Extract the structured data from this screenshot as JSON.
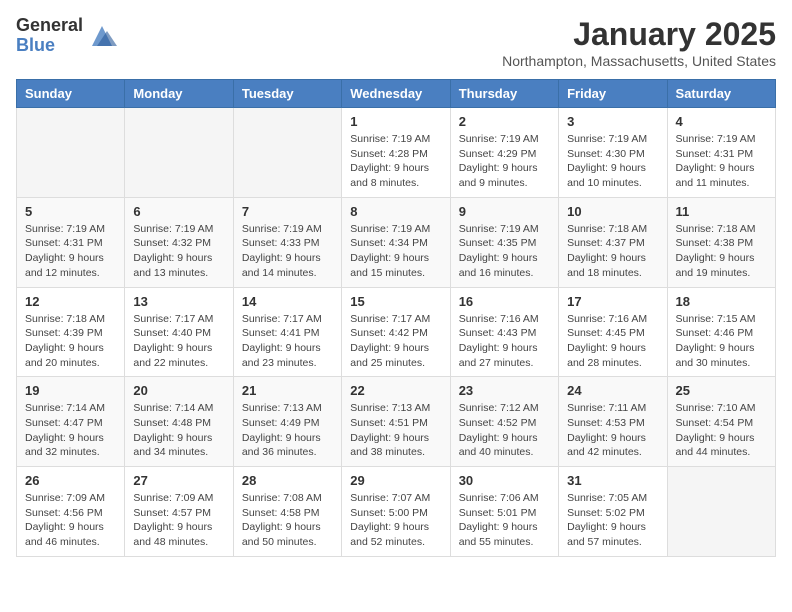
{
  "logo": {
    "general": "General",
    "blue": "Blue"
  },
  "title": "January 2025",
  "location": "Northampton, Massachusetts, United States",
  "weekdays": [
    "Sunday",
    "Monday",
    "Tuesday",
    "Wednesday",
    "Thursday",
    "Friday",
    "Saturday"
  ],
  "weeks": [
    [
      {
        "day": "",
        "info": ""
      },
      {
        "day": "",
        "info": ""
      },
      {
        "day": "",
        "info": ""
      },
      {
        "day": "1",
        "info": "Sunrise: 7:19 AM\nSunset: 4:28 PM\nDaylight: 9 hours\nand 8 minutes."
      },
      {
        "day": "2",
        "info": "Sunrise: 7:19 AM\nSunset: 4:29 PM\nDaylight: 9 hours\nand 9 minutes."
      },
      {
        "day": "3",
        "info": "Sunrise: 7:19 AM\nSunset: 4:30 PM\nDaylight: 9 hours\nand 10 minutes."
      },
      {
        "day": "4",
        "info": "Sunrise: 7:19 AM\nSunset: 4:31 PM\nDaylight: 9 hours\nand 11 minutes."
      }
    ],
    [
      {
        "day": "5",
        "info": "Sunrise: 7:19 AM\nSunset: 4:31 PM\nDaylight: 9 hours\nand 12 minutes."
      },
      {
        "day": "6",
        "info": "Sunrise: 7:19 AM\nSunset: 4:32 PM\nDaylight: 9 hours\nand 13 minutes."
      },
      {
        "day": "7",
        "info": "Sunrise: 7:19 AM\nSunset: 4:33 PM\nDaylight: 9 hours\nand 14 minutes."
      },
      {
        "day": "8",
        "info": "Sunrise: 7:19 AM\nSunset: 4:34 PM\nDaylight: 9 hours\nand 15 minutes."
      },
      {
        "day": "9",
        "info": "Sunrise: 7:19 AM\nSunset: 4:35 PM\nDaylight: 9 hours\nand 16 minutes."
      },
      {
        "day": "10",
        "info": "Sunrise: 7:18 AM\nSunset: 4:37 PM\nDaylight: 9 hours\nand 18 minutes."
      },
      {
        "day": "11",
        "info": "Sunrise: 7:18 AM\nSunset: 4:38 PM\nDaylight: 9 hours\nand 19 minutes."
      }
    ],
    [
      {
        "day": "12",
        "info": "Sunrise: 7:18 AM\nSunset: 4:39 PM\nDaylight: 9 hours\nand 20 minutes."
      },
      {
        "day": "13",
        "info": "Sunrise: 7:17 AM\nSunset: 4:40 PM\nDaylight: 9 hours\nand 22 minutes."
      },
      {
        "day": "14",
        "info": "Sunrise: 7:17 AM\nSunset: 4:41 PM\nDaylight: 9 hours\nand 23 minutes."
      },
      {
        "day": "15",
        "info": "Sunrise: 7:17 AM\nSunset: 4:42 PM\nDaylight: 9 hours\nand 25 minutes."
      },
      {
        "day": "16",
        "info": "Sunrise: 7:16 AM\nSunset: 4:43 PM\nDaylight: 9 hours\nand 27 minutes."
      },
      {
        "day": "17",
        "info": "Sunrise: 7:16 AM\nSunset: 4:45 PM\nDaylight: 9 hours\nand 28 minutes."
      },
      {
        "day": "18",
        "info": "Sunrise: 7:15 AM\nSunset: 4:46 PM\nDaylight: 9 hours\nand 30 minutes."
      }
    ],
    [
      {
        "day": "19",
        "info": "Sunrise: 7:14 AM\nSunset: 4:47 PM\nDaylight: 9 hours\nand 32 minutes."
      },
      {
        "day": "20",
        "info": "Sunrise: 7:14 AM\nSunset: 4:48 PM\nDaylight: 9 hours\nand 34 minutes."
      },
      {
        "day": "21",
        "info": "Sunrise: 7:13 AM\nSunset: 4:49 PM\nDaylight: 9 hours\nand 36 minutes."
      },
      {
        "day": "22",
        "info": "Sunrise: 7:13 AM\nSunset: 4:51 PM\nDaylight: 9 hours\nand 38 minutes."
      },
      {
        "day": "23",
        "info": "Sunrise: 7:12 AM\nSunset: 4:52 PM\nDaylight: 9 hours\nand 40 minutes."
      },
      {
        "day": "24",
        "info": "Sunrise: 7:11 AM\nSunset: 4:53 PM\nDaylight: 9 hours\nand 42 minutes."
      },
      {
        "day": "25",
        "info": "Sunrise: 7:10 AM\nSunset: 4:54 PM\nDaylight: 9 hours\nand 44 minutes."
      }
    ],
    [
      {
        "day": "26",
        "info": "Sunrise: 7:09 AM\nSunset: 4:56 PM\nDaylight: 9 hours\nand 46 minutes."
      },
      {
        "day": "27",
        "info": "Sunrise: 7:09 AM\nSunset: 4:57 PM\nDaylight: 9 hours\nand 48 minutes."
      },
      {
        "day": "28",
        "info": "Sunrise: 7:08 AM\nSunset: 4:58 PM\nDaylight: 9 hours\nand 50 minutes."
      },
      {
        "day": "29",
        "info": "Sunrise: 7:07 AM\nSunset: 5:00 PM\nDaylight: 9 hours\nand 52 minutes."
      },
      {
        "day": "30",
        "info": "Sunrise: 7:06 AM\nSunset: 5:01 PM\nDaylight: 9 hours\nand 55 minutes."
      },
      {
        "day": "31",
        "info": "Sunrise: 7:05 AM\nSunset: 5:02 PM\nDaylight: 9 hours\nand 57 minutes."
      },
      {
        "day": "",
        "info": ""
      }
    ]
  ]
}
